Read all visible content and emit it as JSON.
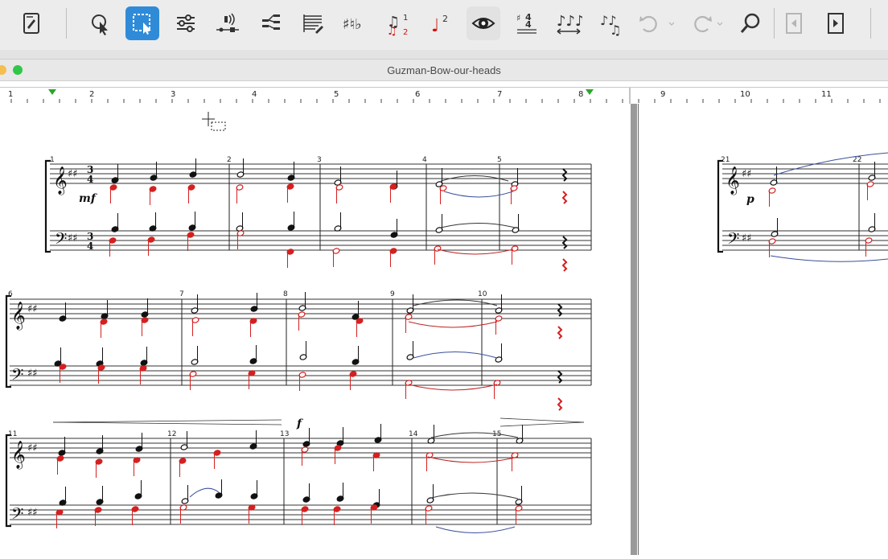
{
  "window": {
    "title": "Guzman-Bow-our-heads",
    "traffic_lights": {
      "yellow": "#f5be4f",
      "green": "#30c748"
    }
  },
  "toolbar": {
    "accent_color": "#2f8bd8",
    "buttons": [
      {
        "icon": "score-manager-icon"
      },
      {
        "icon": "selection-tool-icon"
      },
      {
        "icon": "marquee-tool-icon",
        "active": true
      },
      {
        "icon": "mixer-icon"
      },
      {
        "icon": "audio-playback-icon"
      },
      {
        "icon": "staff-arrange-icon"
      },
      {
        "icon": "page-layout-icon"
      },
      {
        "icon": "accidentals-icon"
      },
      {
        "icon": "voice-2-icon",
        "label": "2"
      },
      {
        "icon": "note-voice-icon",
        "label": "2"
      },
      {
        "icon": "view-eye-icon"
      },
      {
        "icon": "key-time-signature-icon"
      },
      {
        "icon": "beam-spacing-icon"
      },
      {
        "icon": "tuplet-icon"
      },
      {
        "icon": "undo-icon"
      },
      {
        "icon": "redo-icon"
      },
      {
        "icon": "find-icon"
      },
      {
        "icon": "previous-page-icon"
      },
      {
        "icon": "next-page-icon"
      }
    ]
  },
  "ruler": {
    "labels": [
      "1",
      "2",
      "3",
      "4",
      "5",
      "6",
      "7",
      "8",
      "9",
      "10",
      "11"
    ]
  },
  "score": {
    "measure_numbers": [
      "1",
      "2",
      "3",
      "4",
      "5",
      "6",
      "7",
      "8",
      "9",
      "10",
      "11",
      "12",
      "13",
      "14",
      "15",
      "21",
      "22"
    ],
    "dynamics": [
      "mf",
      "f",
      "p"
    ]
  }
}
